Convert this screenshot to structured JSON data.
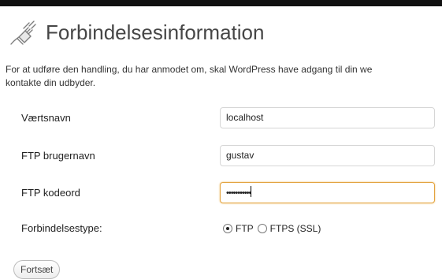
{
  "page": {
    "title": "Forbindelsesinformation",
    "title_icon": "plug-icon",
    "intro_line_1": "For at udføre den handling, du har anmodet om, skal WordPress have adgang til din we",
    "intro_line_2": "kontakte din udbyder."
  },
  "form": {
    "hostname": {
      "label": "Værtsnavn",
      "value": "localhost"
    },
    "username": {
      "label": "FTP brugernavn",
      "value": "gustav"
    },
    "password": {
      "label": "FTP kodeord",
      "masked_value": "•••••••••••"
    },
    "connection_type": {
      "label": "Forbindelsestype:",
      "options": [
        "FTP",
        "FTPS (SSL)"
      ],
      "selected": "FTP"
    },
    "submit_label": "Fortsæt"
  },
  "colors": {
    "title": "#464646",
    "focus_border": "#e3a33e",
    "input_border": "#d6d6d6"
  }
}
